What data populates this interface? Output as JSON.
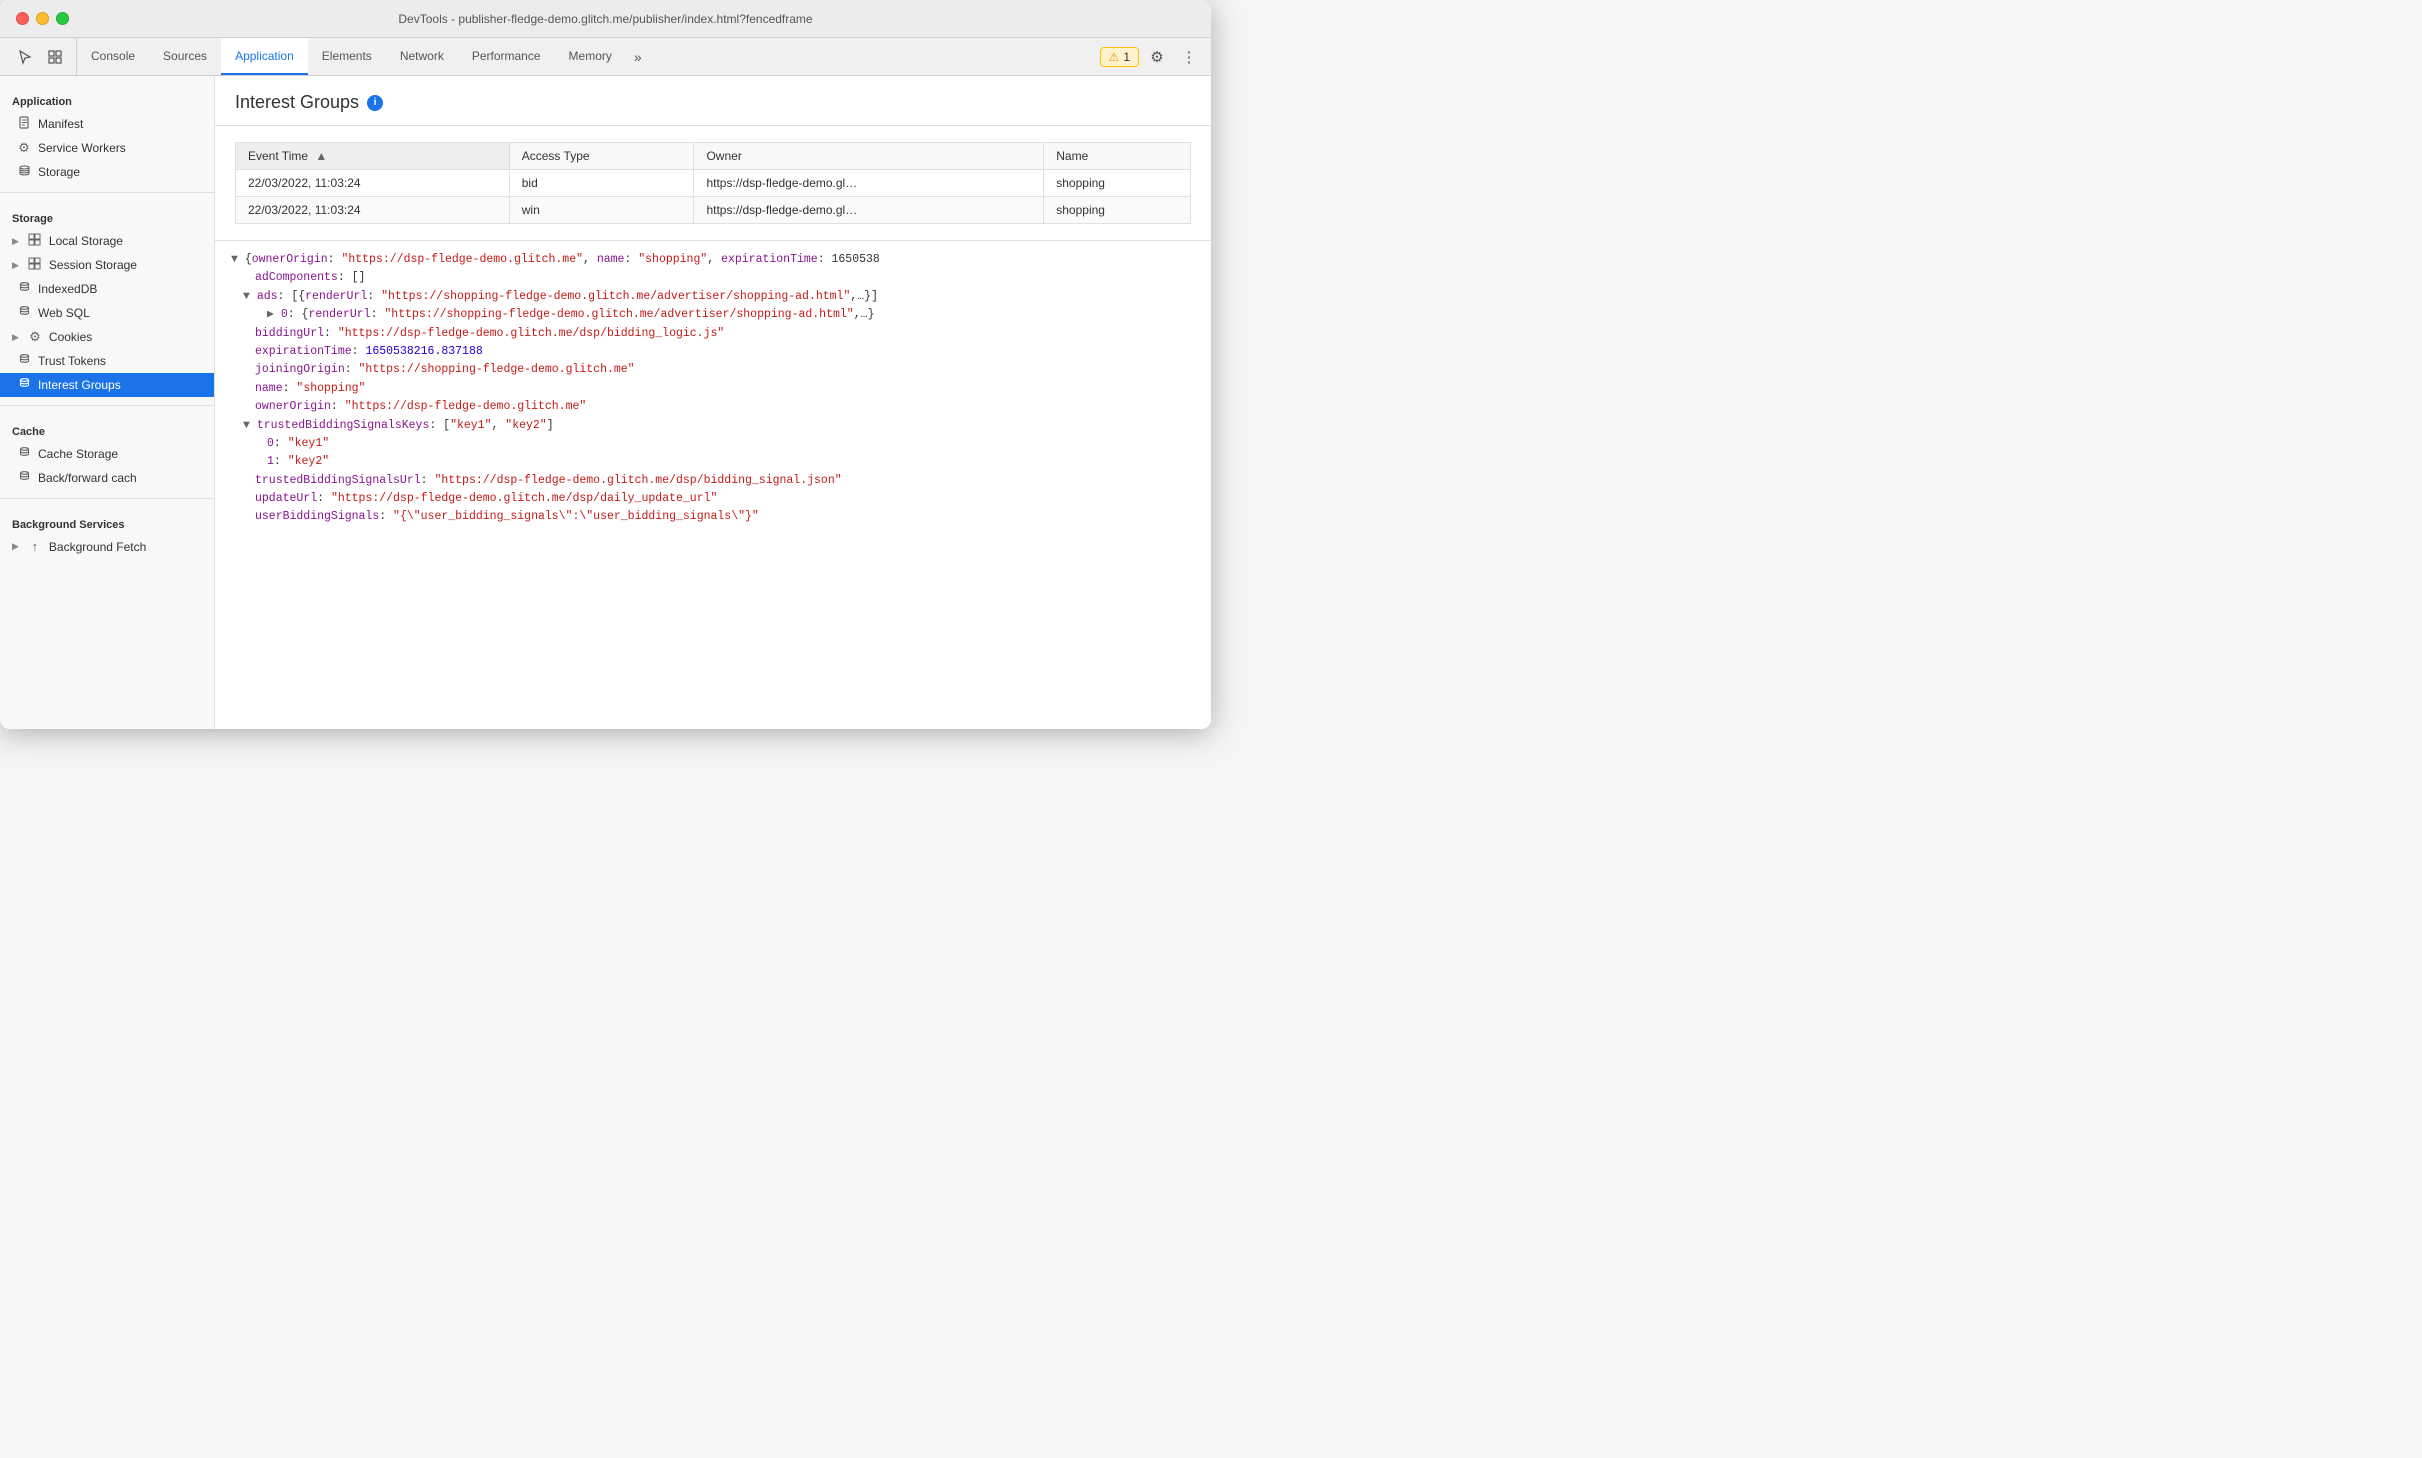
{
  "window": {
    "title": "DevTools - publisher-fledge-demo.glitch.me/publisher/index.html?fencedframe"
  },
  "tabs": [
    {
      "id": "console",
      "label": "Console",
      "active": false
    },
    {
      "id": "sources",
      "label": "Sources",
      "active": false
    },
    {
      "id": "application",
      "label": "Application",
      "active": true
    },
    {
      "id": "elements",
      "label": "Elements",
      "active": false
    },
    {
      "id": "network",
      "label": "Network",
      "active": false
    },
    {
      "id": "performance",
      "label": "Performance",
      "active": false
    },
    {
      "id": "memory",
      "label": "Memory",
      "active": false
    }
  ],
  "warning": {
    "label": "1"
  },
  "sidebar": {
    "sections": [
      {
        "title": "Application",
        "items": [
          {
            "id": "manifest",
            "label": "Manifest",
            "icon": "📄",
            "indent": 1
          },
          {
            "id": "service-workers",
            "label": "Service Workers",
            "icon": "⚙️",
            "indent": 1
          },
          {
            "id": "storage",
            "label": "Storage",
            "icon": "🗄️",
            "indent": 1
          }
        ]
      },
      {
        "title": "Storage",
        "items": [
          {
            "id": "local-storage",
            "label": "Local Storage",
            "icon": "▶",
            "hasArrow": true,
            "indent": 1,
            "iconType": "grid"
          },
          {
            "id": "session-storage",
            "label": "Session Storage",
            "icon": "▶",
            "hasArrow": true,
            "indent": 1,
            "iconType": "grid"
          },
          {
            "id": "indexeddb",
            "label": "IndexedDB",
            "icon": "",
            "indent": 1,
            "iconType": "db"
          },
          {
            "id": "web-sql",
            "label": "Web SQL",
            "icon": "",
            "indent": 1,
            "iconType": "db"
          },
          {
            "id": "cookies",
            "label": "Cookies",
            "icon": "▶",
            "hasArrow": true,
            "indent": 1,
            "iconType": "cookie"
          },
          {
            "id": "trust-tokens",
            "label": "Trust Tokens",
            "icon": "",
            "indent": 1,
            "iconType": "db"
          },
          {
            "id": "interest-groups",
            "label": "Interest Groups",
            "icon": "",
            "indent": 1,
            "iconType": "db",
            "active": true
          }
        ]
      },
      {
        "title": "Cache",
        "items": [
          {
            "id": "cache-storage",
            "label": "Cache Storage",
            "icon": "",
            "indent": 1,
            "iconType": "db"
          },
          {
            "id": "back-forward-cache",
            "label": "Back/forward cach",
            "icon": "",
            "indent": 1,
            "iconType": "db"
          }
        ]
      },
      {
        "title": "Background Services",
        "items": [
          {
            "id": "background-fetch",
            "label": "Background Fetch",
            "icon": "▶",
            "hasArrow": true,
            "indent": 1
          }
        ]
      }
    ]
  },
  "panel": {
    "title": "Interest Groups",
    "table": {
      "columns": [
        "Event Time",
        "Access Type",
        "Owner",
        "Name"
      ],
      "rows": [
        {
          "eventTime": "22/03/2022, 11:03:24",
          "accessType": "bid",
          "owner": "https://dsp-fledge-demo.gl…",
          "name": "shopping"
        },
        {
          "eventTime": "22/03/2022, 11:03:24",
          "accessType": "win",
          "owner": "https://dsp-fledge-demo.gl…",
          "name": "shopping"
        }
      ]
    },
    "json": {
      "line1": "▼ {ownerOrigin: \"https://dsp-fledge-demo.glitch.me\", name: \"shopping\", expirationTime: 1650538",
      "line2": "    adComponents: []",
      "line3": "  ▼ ads: [{renderUrl: \"https://shopping-fledge-demo.glitch.me/advertiser/shopping-ad.html\",…}]",
      "line4": "      ▶ 0: {renderUrl: \"https://shopping-fledge-demo.glitch.me/advertiser/shopping-ad.html\",…}",
      "line5": "    biddingUrl: \"https://dsp-fledge-demo.glitch.me/dsp/bidding_logic.js\"",
      "line6": "    expirationTime: 1650538216.837188",
      "line7": "    joiningOrigin: \"https://shopping-fledge-demo.glitch.me\"",
      "line8": "    name: \"shopping\"",
      "line9": "    ownerOrigin: \"https://dsp-fledge-demo.glitch.me\"",
      "line10": "  ▼ trustedBiddingSignalsKeys: [\"key1\", \"key2\"]",
      "line11": "      0: \"key1\"",
      "line12": "      1: \"key2\"",
      "line13": "    trustedBiddingSignalsUrl: \"https://dsp-fledge-demo.glitch.me/dsp/bidding_signal.json\"",
      "line14": "    updateUrl: \"https://dsp-fledge-demo.glitch.me/dsp/daily_update_url\"",
      "line15": "    userBiddingSignals: \"{\\\"user_bidding_signals\\\":\\\"user_bidding_signals\\\"}\""
    }
  }
}
